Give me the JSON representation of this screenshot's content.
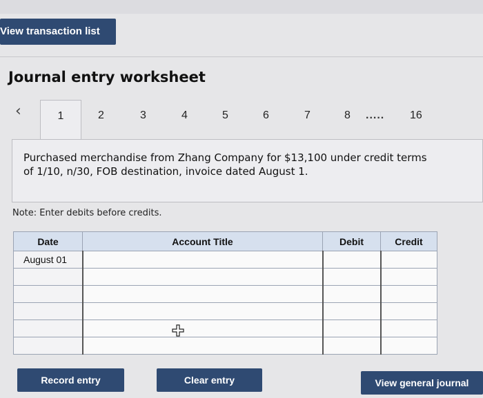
{
  "header": {
    "view_transaction_list_label": "View transaction list"
  },
  "worksheet": {
    "title": "Journal entry worksheet",
    "tabs": {
      "prev_icon": "chevron-left-icon",
      "items": [
        "1",
        "2",
        "3",
        "4",
        "5",
        "6",
        "7",
        "8"
      ],
      "ellipsis": ".....",
      "last": "16",
      "active_index": 0
    },
    "description": "Purchased merchandise from Zhang Company for $13,100 under credit terms of 1/10, n/30, FOB destination, invoice dated August 1.",
    "note": "Note: Enter debits before credits."
  },
  "table": {
    "headers": {
      "date": "Date",
      "account_title": "Account Title",
      "debit": "Debit",
      "credit": "Credit"
    },
    "rows": [
      {
        "date": "August 01",
        "account_title": "",
        "debit": "",
        "credit": ""
      },
      {
        "date": "",
        "account_title": "",
        "debit": "",
        "credit": ""
      },
      {
        "date": "",
        "account_title": "",
        "debit": "",
        "credit": ""
      },
      {
        "date": "",
        "account_title": "",
        "debit": "",
        "credit": ""
      },
      {
        "date": "",
        "account_title": "",
        "debit": "",
        "credit": ""
      },
      {
        "date": "",
        "account_title": "",
        "debit": "",
        "credit": ""
      }
    ]
  },
  "buttons": {
    "record_entry": "Record entry",
    "clear_entry": "Clear entry",
    "view_general_journal": "View general journal"
  },
  "icons": {
    "cursor": "move-cursor-icon"
  },
  "colors": {
    "button_bg": "#2f4a72",
    "table_header_bg": "#d6e0ee",
    "panel_bg": "#ededf0"
  }
}
